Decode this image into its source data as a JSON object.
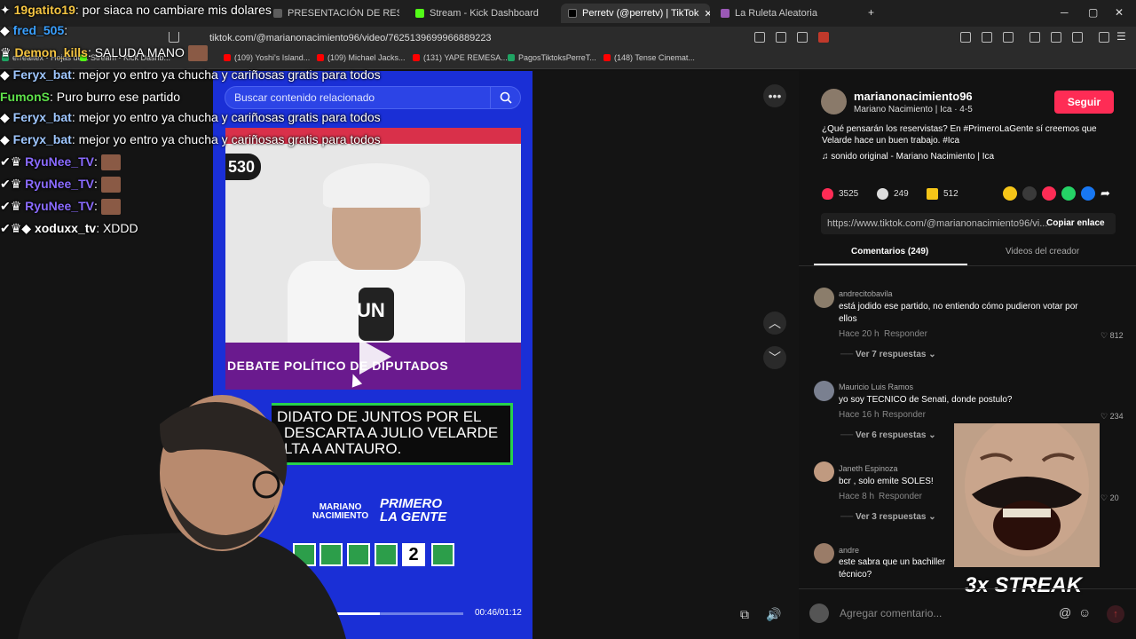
{
  "browser": {
    "tabs": [
      {
        "label": "PRESENTACIÓN DE RESULTA",
        "color": "#5d5d5d"
      },
      {
        "label": "Stream - Kick Dashboard",
        "color": "#53fc18"
      },
      {
        "label": "Perretv (@perretv) | TikTok",
        "color": "#111111"
      },
      {
        "label": "La Ruleta Aleatoria",
        "color": "#9b59b6"
      }
    ],
    "url": "tiktok.com/@marianonacimiento96/video/7625139699966889223",
    "bookmarks": [
      {
        "label": "errealtex - Hojas de...",
        "color": "#1fa463"
      },
      {
        "label": "Stream - Kick Dashb...",
        "color": "#53fc18"
      },
      {
        "label": "(109) Yoshi's Island...",
        "color": "#ff0000"
      },
      {
        "label": "(109) Michael Jacks...",
        "color": "#ff0000"
      },
      {
        "label": "(131) YAPE REMESA...",
        "color": "#ff0000"
      },
      {
        "label": "PagosTiktoksPerreT...",
        "color": "#1fa463"
      },
      {
        "label": "(148) Tense Cinemat...",
        "color": "#ff0000"
      }
    ]
  },
  "chat": [
    {
      "user": "19gatito19",
      "sep": ": ",
      "text": "por siaca no cambiare mis dolares",
      "color": "#f5c542"
    },
    {
      "user": "fred_505",
      "sep": ": ",
      "text": "",
      "color": "#3aa0ff"
    },
    {
      "user": "Demon_kills",
      "sep": ": ",
      "text": "SALUDA MANO",
      "color": "#f5c542"
    },
    {
      "user": "Feryx_bat",
      "sep": ": ",
      "text": "mejor yo entro ya  chucha y cariñosas gratis para todos",
      "color": "#9fc7ff"
    },
    {
      "user": "FumonS",
      "sep": ": ",
      "text": "Puro burro ese partido",
      "color": "#5ee04a"
    },
    {
      "user": "Feryx_bat",
      "sep": ": ",
      "text": "mejor yo entro ya  chucha y cariñosas gratis para todos",
      "color": "#9fc7ff"
    },
    {
      "user": "Feryx_bat",
      "sep": ": ",
      "text": "mejor yo entro ya  chucha y cariñosas gratis para todos",
      "color": "#9fc7ff"
    },
    {
      "user": "RyuNee_TV",
      "sep": ": ",
      "text": "",
      "color": "#8a6bff"
    },
    {
      "user": "RyuNee_TV",
      "sep": ": ",
      "text": "",
      "color": "#8a6bff"
    },
    {
      "user": "RyuNee_TV",
      "sep": ": ",
      "text": "",
      "color": "#8a6bff"
    },
    {
      "user": "xoduxx_tv",
      "sep": ": ",
      "text": "XDDD",
      "color": "#e8e8e8"
    }
  ],
  "video": {
    "search_placeholder": "Buscar contenido relacionado",
    "badge": "530",
    "caption_word": "UN",
    "caption_line": "DEBATE POLÍTICO DE DIPUTADOS",
    "banner_lines": [
      "DIDATO DE JUNTOS POR EL",
      "DESCARTA A JULIO VELARDE",
      "LTA A ANTAURO."
    ],
    "logo_left": "MARIANO\nNACIMIENTO",
    "logo_right": "PRIMERO\nLA GENTE",
    "ballot_number": "2",
    "time": "00:46/01:12",
    "progress": 0.52
  },
  "creator": {
    "username": "marianonacimiento96",
    "subtitle": "Mariano Nacimiento | Ica · 4-5",
    "follow_label": "Seguir",
    "description": "¿Qué pensarán los reservistas? En #PrimeroLaGente sí creemos que Velarde hace un buen trabajo. #Ica",
    "sound": "sonido original - Mariano Nacimiento | Ica",
    "likes": "3525",
    "comments": "249",
    "saves": "512",
    "link": "https://www.tiktok.com/@marianonacimiento96/vi...",
    "copy_label": "Copiar enlace"
  },
  "tabs": {
    "comments": "Comentarios (249)",
    "videos": "Videos del creador"
  },
  "comments": [
    {
      "user": "andrecitobavila",
      "text": "está jodido ese partido, no entiendo cómo pudieron votar por ellos",
      "time": "Hace 20 h",
      "reply": "Responder",
      "likes": "812",
      "replies": "Ver 7 respuestas"
    },
    {
      "user": "Mauricio Luis Ramos",
      "text": "yo soy TECNICO de Senati, donde postulo?",
      "time": "Hace 16 h",
      "reply": "Responder",
      "likes": "234",
      "replies": "Ver 6 respuestas"
    },
    {
      "user": "Janeth Espinoza",
      "text": "bcr , solo emite SOLES!",
      "time": "Hace 8 h",
      "reply": "Responder",
      "likes": "20",
      "replies": "Ver 3 respuestas"
    },
    {
      "user": "andre",
      "text": "este sabra que un bachiller técnico?",
      "time": "",
      "reply": "",
      "likes": "",
      "replies": ""
    }
  ],
  "overlay": {
    "streak": "3x STREAK"
  },
  "comment_input": {
    "placeholder": "Agregar comentario..."
  }
}
